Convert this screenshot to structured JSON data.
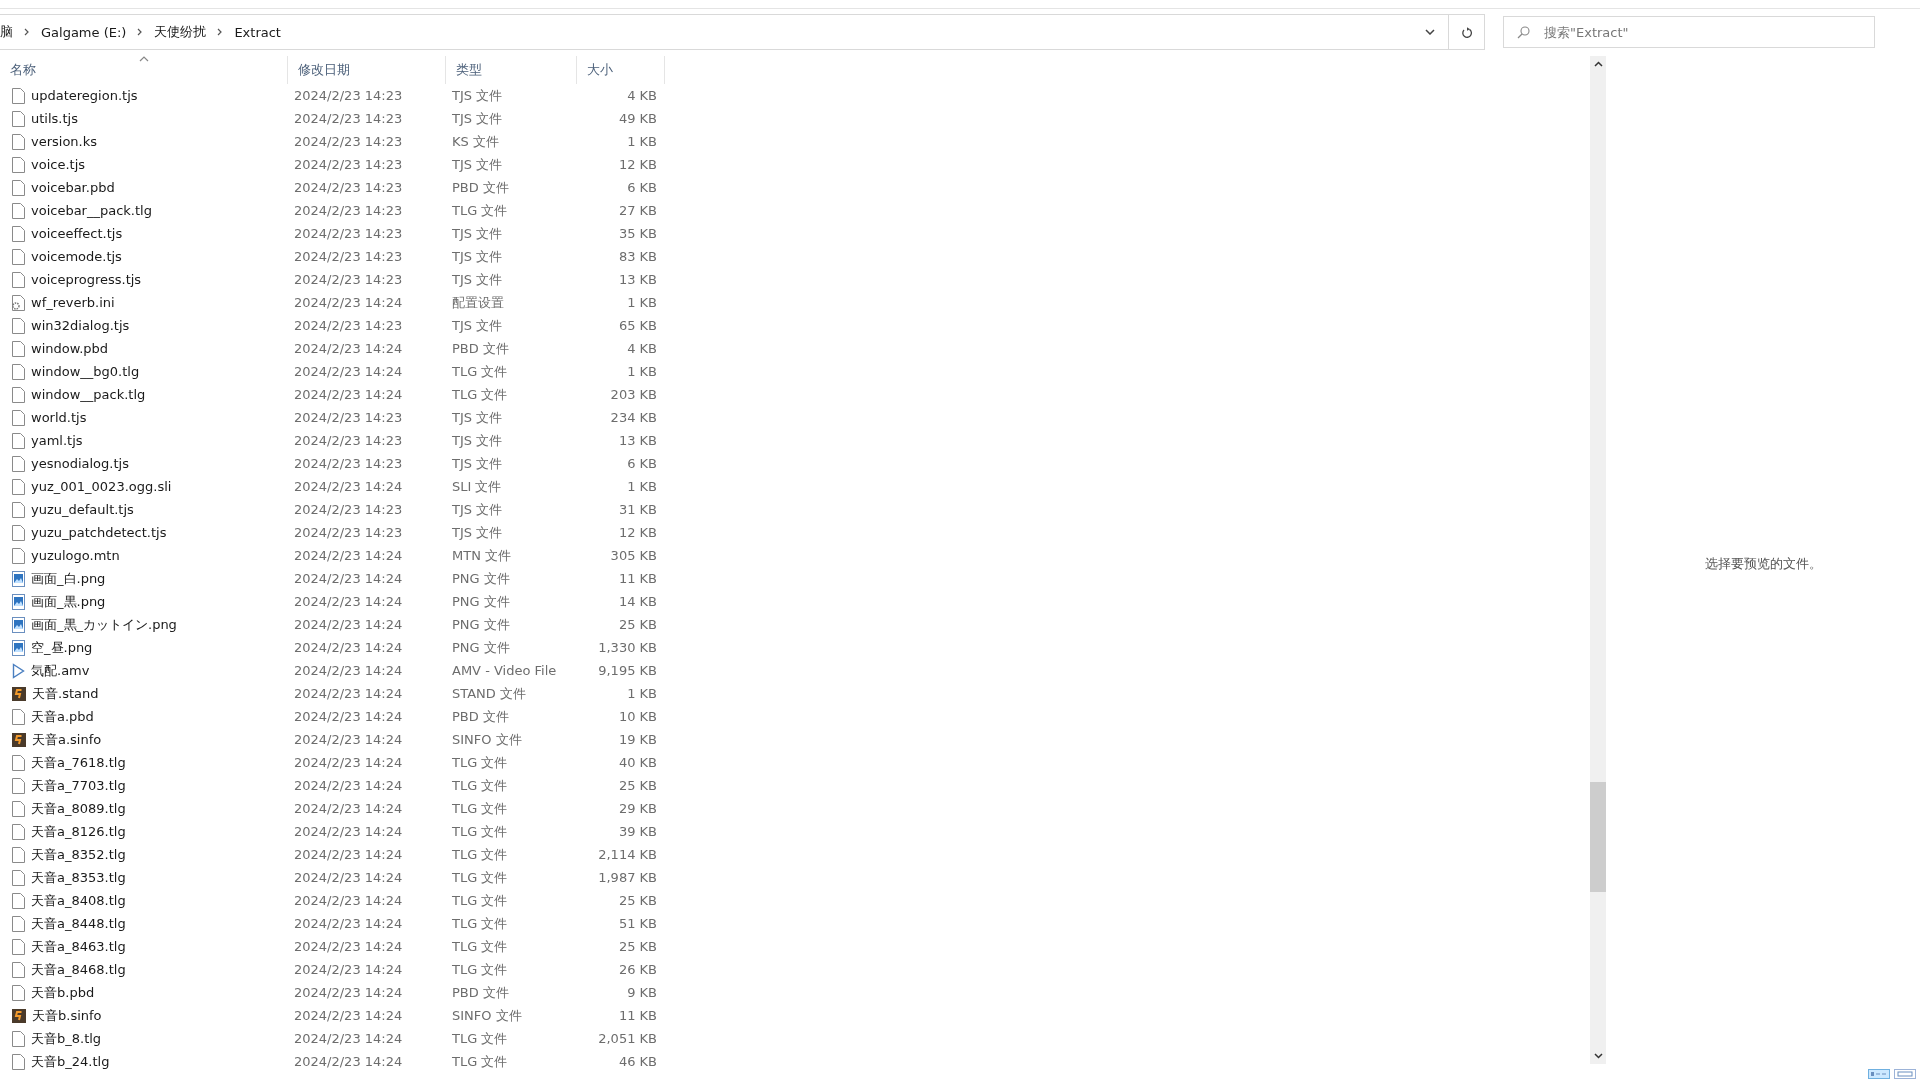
{
  "address_bar": {
    "crumbs": [
      "脑",
      "Galgame (E:)",
      "天使纷扰",
      "Extract"
    ]
  },
  "search": {
    "placeholder": "搜索\"Extract\""
  },
  "columns": [
    {
      "label": "名称",
      "sorted": true
    },
    {
      "label": "修改日期",
      "sorted": false
    },
    {
      "label": "类型",
      "sorted": false
    },
    {
      "label": "大小",
      "sorted": false
    }
  ],
  "rows": [
    {
      "kind": "file",
      "name": "updateregion.tjs",
      "date": "2024/2/23 14:23",
      "type": "TJS 文件",
      "size": "4 KB"
    },
    {
      "kind": "file",
      "name": "utils.tjs",
      "date": "2024/2/23 14:23",
      "type": "TJS 文件",
      "size": "49 KB"
    },
    {
      "kind": "file",
      "name": "version.ks",
      "date": "2024/2/23 14:23",
      "type": "KS 文件",
      "size": "1 KB"
    },
    {
      "kind": "file",
      "name": "voice.tjs",
      "date": "2024/2/23 14:23",
      "type": "TJS 文件",
      "size": "12 KB"
    },
    {
      "kind": "file",
      "name": "voicebar.pbd",
      "date": "2024/2/23 14:23",
      "type": "PBD 文件",
      "size": "6 KB"
    },
    {
      "kind": "file",
      "name": "voicebar__pack.tlg",
      "date": "2024/2/23 14:23",
      "type": "TLG 文件",
      "size": "27 KB"
    },
    {
      "kind": "file",
      "name": "voiceeffect.tjs",
      "date": "2024/2/23 14:23",
      "type": "TJS 文件",
      "size": "35 KB"
    },
    {
      "kind": "file",
      "name": "voicemode.tjs",
      "date": "2024/2/23 14:23",
      "type": "TJS 文件",
      "size": "83 KB"
    },
    {
      "kind": "file",
      "name": "voiceprogress.tjs",
      "date": "2024/2/23 14:23",
      "type": "TJS 文件",
      "size": "13 KB"
    },
    {
      "kind": "settings",
      "name": "wf_reverb.ini",
      "date": "2024/2/23 14:24",
      "type": "配置设置",
      "size": "1 KB"
    },
    {
      "kind": "file",
      "name": "win32dialog.tjs",
      "date": "2024/2/23 14:23",
      "type": "TJS 文件",
      "size": "65 KB"
    },
    {
      "kind": "file",
      "name": "window.pbd",
      "date": "2024/2/23 14:24",
      "type": "PBD 文件",
      "size": "4 KB"
    },
    {
      "kind": "file",
      "name": "window__bg0.tlg",
      "date": "2024/2/23 14:24",
      "type": "TLG 文件",
      "size": "1 KB"
    },
    {
      "kind": "file",
      "name": "window__pack.tlg",
      "date": "2024/2/23 14:24",
      "type": "TLG 文件",
      "size": "203 KB"
    },
    {
      "kind": "file",
      "name": "world.tjs",
      "date": "2024/2/23 14:23",
      "type": "TJS 文件",
      "size": "234 KB"
    },
    {
      "kind": "file",
      "name": "yaml.tjs",
      "date": "2024/2/23 14:23",
      "type": "TJS 文件",
      "size": "13 KB"
    },
    {
      "kind": "file",
      "name": "yesnodialog.tjs",
      "date": "2024/2/23 14:23",
      "type": "TJS 文件",
      "size": "6 KB"
    },
    {
      "kind": "file",
      "name": "yuz_001_0023.ogg.sli",
      "date": "2024/2/23 14:24",
      "type": "SLI 文件",
      "size": "1 KB"
    },
    {
      "kind": "file",
      "name": "yuzu_default.tjs",
      "date": "2024/2/23 14:23",
      "type": "TJS 文件",
      "size": "31 KB"
    },
    {
      "kind": "file",
      "name": "yuzu_patchdetect.tjs",
      "date": "2024/2/23 14:23",
      "type": "TJS 文件",
      "size": "12 KB"
    },
    {
      "kind": "file",
      "name": "yuzulogo.mtn",
      "date": "2024/2/23 14:24",
      "type": "MTN 文件",
      "size": "305 KB"
    },
    {
      "kind": "image",
      "name": "画面_白.png",
      "date": "2024/2/23 14:24",
      "type": "PNG 文件",
      "size": "11 KB"
    },
    {
      "kind": "image",
      "name": "画面_黒.png",
      "date": "2024/2/23 14:24",
      "type": "PNG 文件",
      "size": "14 KB"
    },
    {
      "kind": "image",
      "name": "画面_黒_カットイン.png",
      "date": "2024/2/23 14:24",
      "type": "PNG 文件",
      "size": "25 KB"
    },
    {
      "kind": "image",
      "name": "空_昼.png",
      "date": "2024/2/23 14:24",
      "type": "PNG 文件",
      "size": "1,330 KB"
    },
    {
      "kind": "video",
      "name": "気配.amv",
      "date": "2024/2/23 14:24",
      "type": "AMV - Video File",
      "size": "9,195 KB"
    },
    {
      "kind": "app",
      "name": "天音.stand",
      "date": "2024/2/23 14:24",
      "type": "STAND 文件",
      "size": "1 KB"
    },
    {
      "kind": "file",
      "name": "天音a.pbd",
      "date": "2024/2/23 14:24",
      "type": "PBD 文件",
      "size": "10 KB"
    },
    {
      "kind": "app",
      "name": "天音a.sinfo",
      "date": "2024/2/23 14:24",
      "type": "SINFO 文件",
      "size": "19 KB"
    },
    {
      "kind": "file",
      "name": "天音a_7618.tlg",
      "date": "2024/2/23 14:24",
      "type": "TLG 文件",
      "size": "40 KB"
    },
    {
      "kind": "file",
      "name": "天音a_7703.tlg",
      "date": "2024/2/23 14:24",
      "type": "TLG 文件",
      "size": "25 KB"
    },
    {
      "kind": "file",
      "name": "天音a_8089.tlg",
      "date": "2024/2/23 14:24",
      "type": "TLG 文件",
      "size": "29 KB"
    },
    {
      "kind": "file",
      "name": "天音a_8126.tlg",
      "date": "2024/2/23 14:24",
      "type": "TLG 文件",
      "size": "39 KB"
    },
    {
      "kind": "file",
      "name": "天音a_8352.tlg",
      "date": "2024/2/23 14:24",
      "type": "TLG 文件",
      "size": "2,114 KB"
    },
    {
      "kind": "file",
      "name": "天音a_8353.tlg",
      "date": "2024/2/23 14:24",
      "type": "TLG 文件",
      "size": "1,987 KB"
    },
    {
      "kind": "file",
      "name": "天音a_8408.tlg",
      "date": "2024/2/23 14:24",
      "type": "TLG 文件",
      "size": "25 KB"
    },
    {
      "kind": "file",
      "name": "天音a_8448.tlg",
      "date": "2024/2/23 14:24",
      "type": "TLG 文件",
      "size": "51 KB"
    },
    {
      "kind": "file",
      "name": "天音a_8463.tlg",
      "date": "2024/2/23 14:24",
      "type": "TLG 文件",
      "size": "25 KB"
    },
    {
      "kind": "file",
      "name": "天音a_8468.tlg",
      "date": "2024/2/23 14:24",
      "type": "TLG 文件",
      "size": "26 KB"
    },
    {
      "kind": "file",
      "name": "天音b.pbd",
      "date": "2024/2/23 14:24",
      "type": "PBD 文件",
      "size": "9 KB"
    },
    {
      "kind": "app",
      "name": "天音b.sinfo",
      "date": "2024/2/23 14:24",
      "type": "SINFO 文件",
      "size": "11 KB"
    },
    {
      "kind": "file",
      "name": "天音b_8.tlg",
      "date": "2024/2/23 14:24",
      "type": "TLG 文件",
      "size": "2,051 KB"
    },
    {
      "kind": "file",
      "name": "天音b_24.tlg",
      "date": "2024/2/23 14:24",
      "type": "TLG 文件",
      "size": "46 KB"
    }
  ],
  "preview": {
    "message": "选择要预览的文件。"
  },
  "view_buttons": [
    {
      "kind": "details",
      "selected": true
    },
    {
      "kind": "tiles",
      "selected": false
    }
  ]
}
